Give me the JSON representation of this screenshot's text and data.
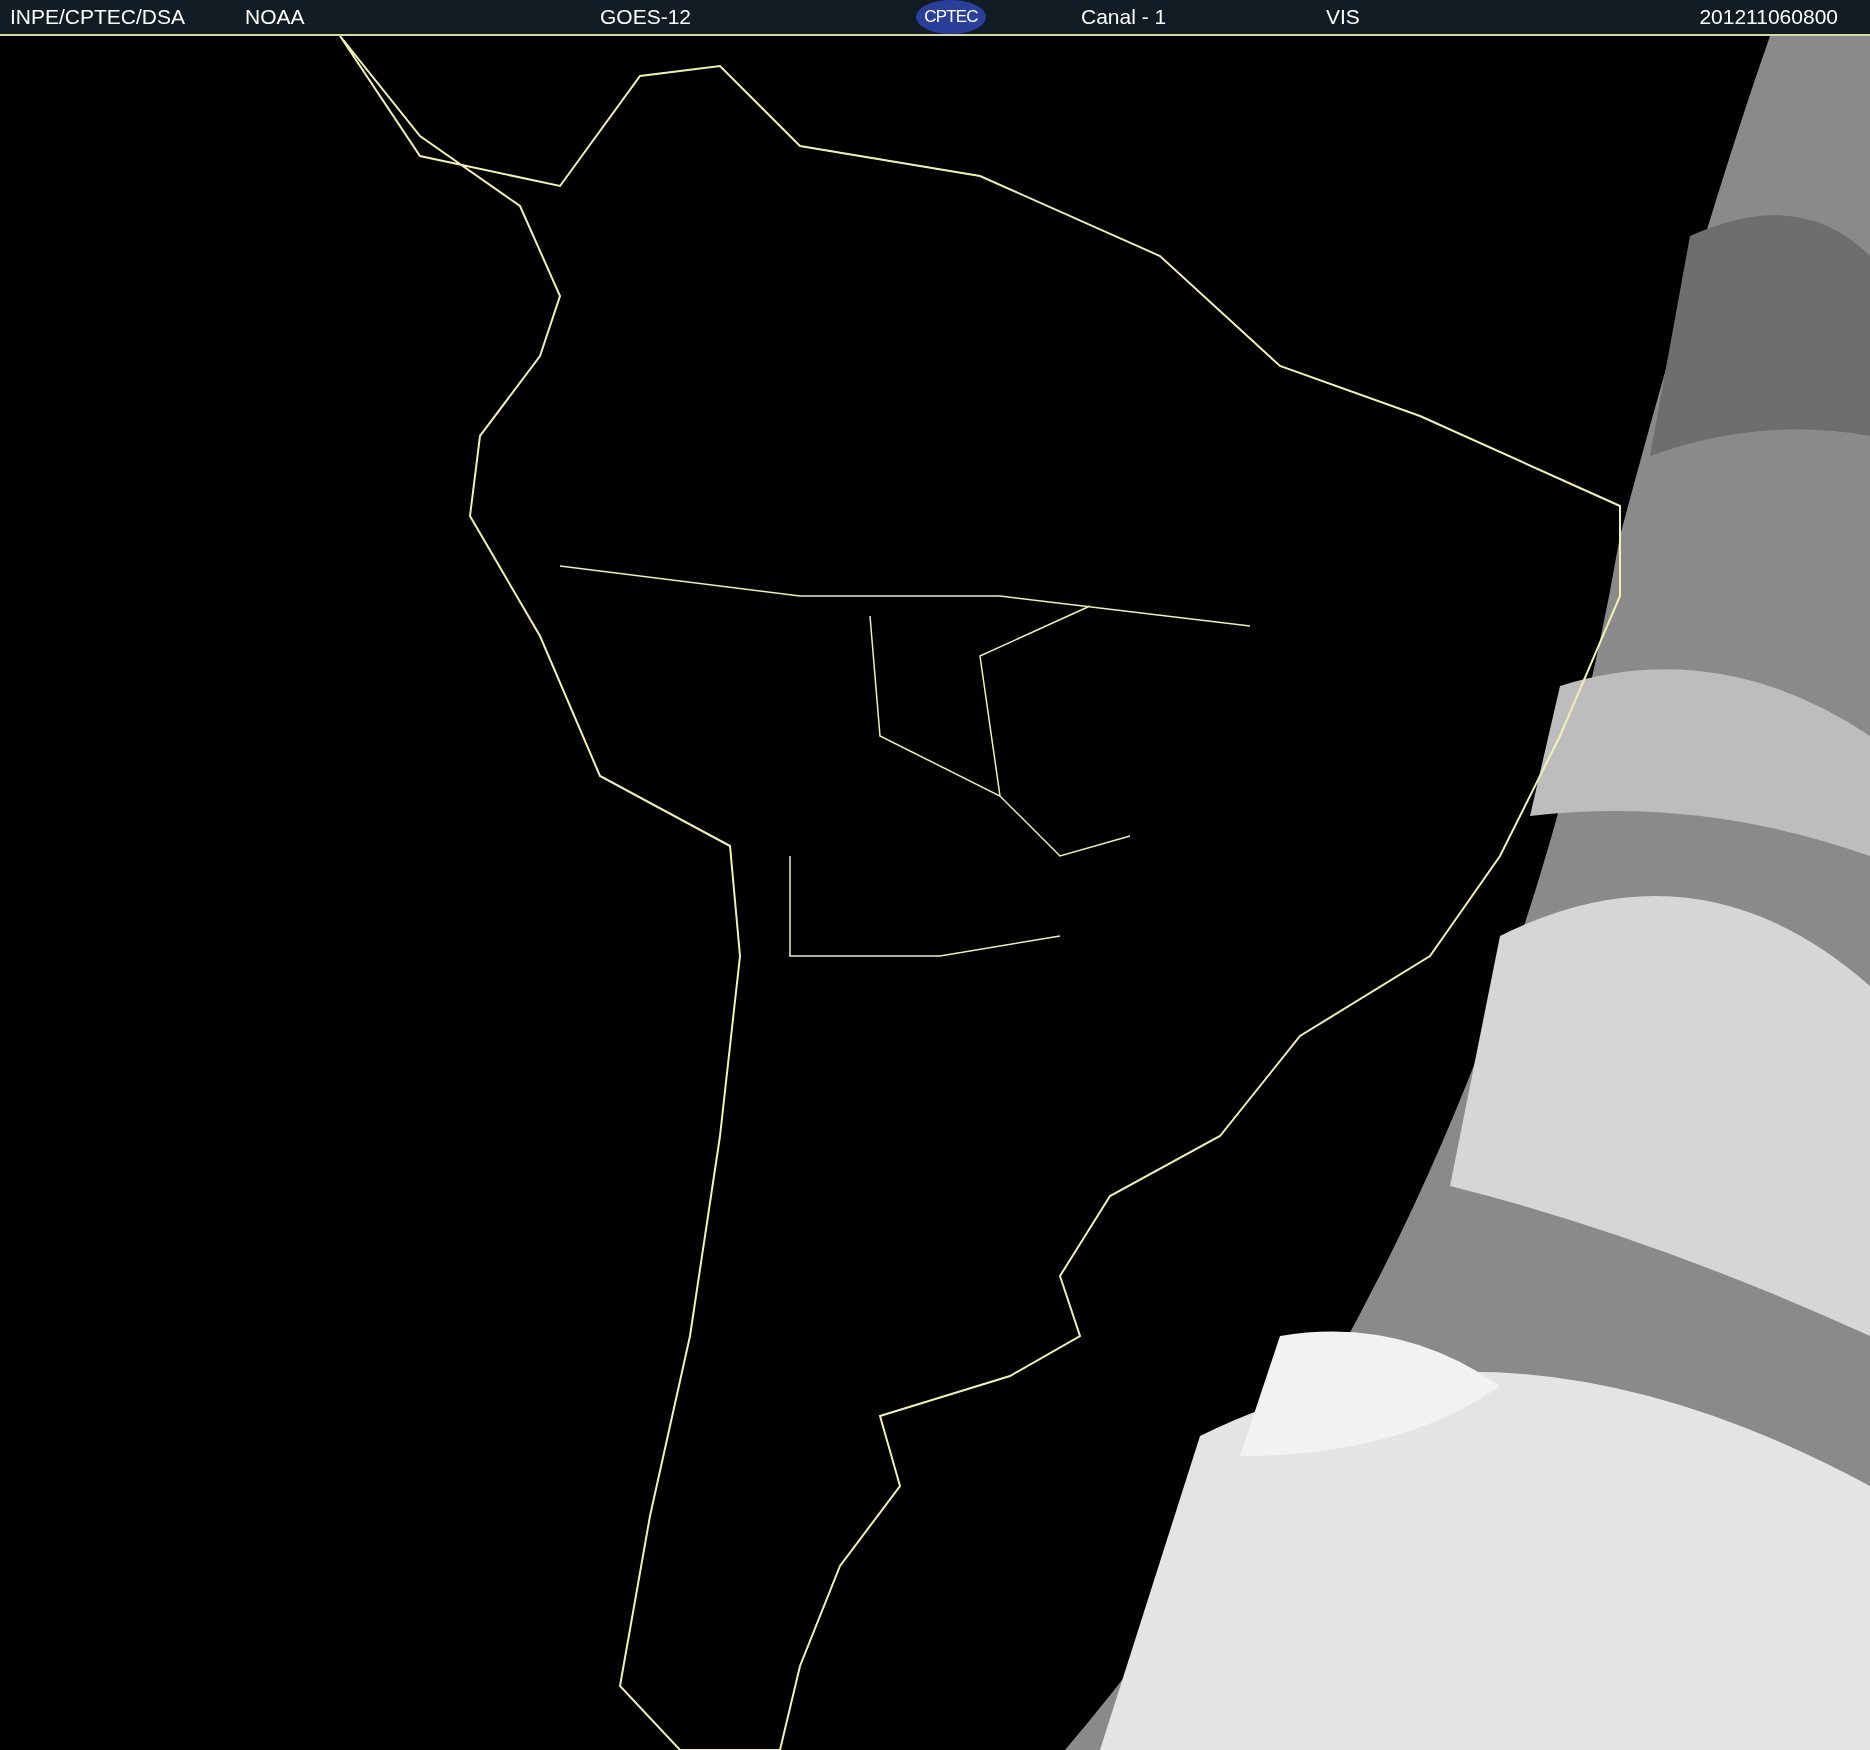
{
  "header": {
    "source": "INPE/CPTEC/DSA",
    "agency": "NOAA",
    "satellite": "GOES-12",
    "logo": "CPTEC",
    "channel": "Canal - 1",
    "band": "VIS",
    "timestamp": "201211060800"
  }
}
